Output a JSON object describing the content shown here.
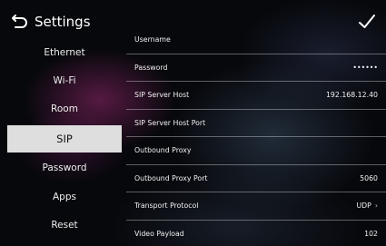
{
  "header": {
    "title": "Settings",
    "back_icon": "back-arrow-icon",
    "confirm_icon": "checkmark-icon"
  },
  "sidebar": {
    "active": "SIP",
    "items": [
      {
        "label": "Ethernet"
      },
      {
        "label": "Wi-Fi"
      },
      {
        "label": "Room"
      },
      {
        "label": "SIP"
      },
      {
        "label": "Password"
      },
      {
        "label": "Apps"
      },
      {
        "label": "Reset"
      }
    ]
  },
  "sip": {
    "rows": [
      {
        "label": "Username",
        "value": ""
      },
      {
        "label": "Password",
        "value": "••••••"
      },
      {
        "label": "SIP Server Host",
        "value": "192.168.12.40"
      },
      {
        "label": "SIP Server Host Port",
        "value": ""
      },
      {
        "label": "Outbound Proxy",
        "value": ""
      },
      {
        "label": "Outbound Proxy Port",
        "value": "5060"
      },
      {
        "label": "Transport Protocol",
        "value": "UDP",
        "chevron": "›"
      },
      {
        "label": "Video Payload",
        "value": "102"
      }
    ]
  }
}
